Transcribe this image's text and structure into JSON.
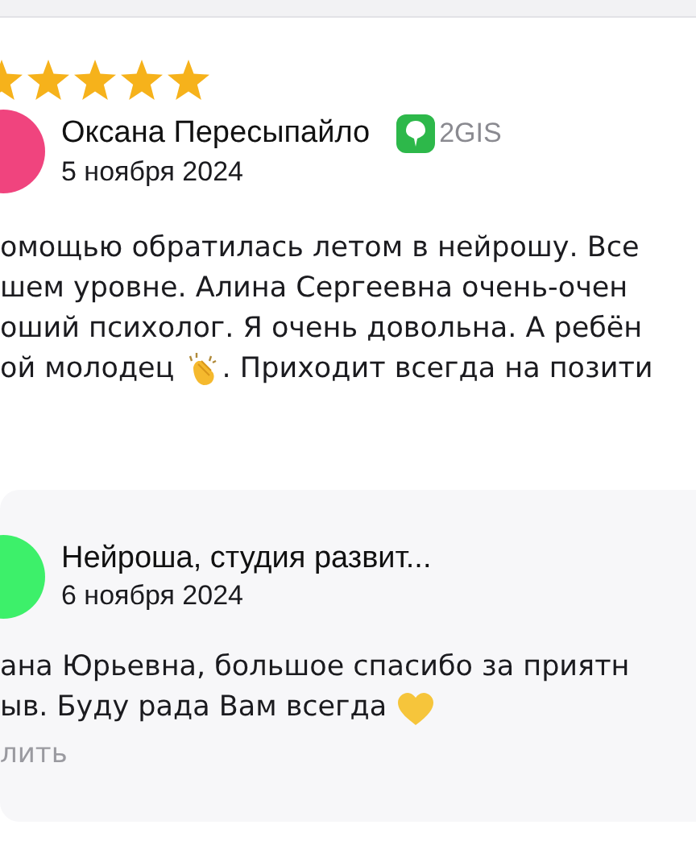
{
  "review": {
    "stars": 5,
    "author": "Оксана Пересыпайло",
    "source": "2GIS",
    "date": "5 ноября 2024",
    "lines": [
      [
        {
          "text": "омощью обратилась летом в нейрошу. Все"
        }
      ],
      [
        {
          "text": "шем уровне. Алина Сергеевна очень-очен"
        }
      ],
      [
        {
          "text": "оший психолог. Я очень довольна. А ребён"
        }
      ],
      [
        {
          "text": "ой молодец "
        },
        {
          "kind": "clap"
        },
        {
          "text": ". Приходит всегда на позити"
        }
      ]
    ]
  },
  "reply": {
    "author": "Нейроша, студия развит...",
    "date": "6 ноября 2024",
    "lines": [
      [
        {
          "text": "ана Юрьевна, большое спасибо за приятн"
        }
      ],
      [
        {
          "text": "ыв. Буду рада Вам всегда "
        },
        {
          "kind": "heart"
        }
      ]
    ],
    "action": "лить"
  }
}
